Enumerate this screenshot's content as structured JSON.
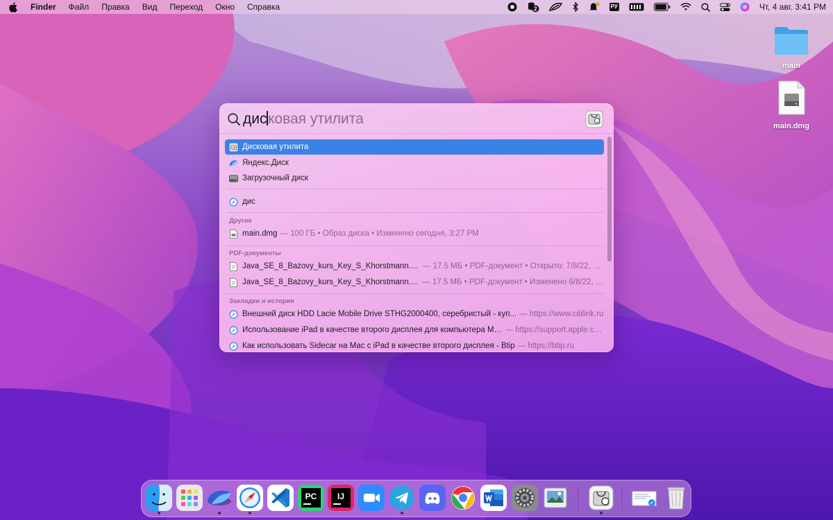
{
  "menubar": {
    "app_name": "Finder",
    "items": [
      "Файл",
      "Правка",
      "Вид",
      "Переход",
      "Окно",
      "Справка"
    ],
    "input_source": "РУ",
    "clock": "Чт, 4 авг.  3:41 PM",
    "status_icons": [
      "stop-icon",
      "notification-badge-icon",
      "racket-icon",
      "bluetooth-icon",
      "bell-icon",
      "keyboard-layout-icon",
      "battery-icon",
      "wifi-icon",
      "search-icon",
      "control-center-icon",
      "siri-icon"
    ],
    "badge_count": "2"
  },
  "desktop": {
    "icons": [
      {
        "label": "main",
        "icon": "folder-icon"
      },
      {
        "label": "main.dmg",
        "icon": "disk-image-icon"
      }
    ]
  },
  "spotlight": {
    "typed": "дис",
    "completion": "ковая утилита",
    "results": [
      {
        "title": "Дисковая утилита",
        "meta": "",
        "icon": "disk-utility-icon",
        "selected": true
      },
      {
        "title": "Яндекс.Диск",
        "meta": "",
        "icon": "yandex-disk-icon",
        "selected": false
      },
      {
        "title": "Загрузочный диск",
        "meta": "",
        "icon": "startup-disk-icon",
        "selected": false
      }
    ],
    "web_suggestion": {
      "title": "дис",
      "icon": "safari-icon"
    },
    "sections": {
      "other": {
        "label": "Другие",
        "items": [
          {
            "title": "main.dmg",
            "meta": "— 100 ГБ • Образ диска • Изменено сегодня, 3:27 PM",
            "icon": "document-icon"
          }
        ]
      },
      "pdf": {
        "label": "PDF-документы",
        "items": [
          {
            "title": "Java_SE_8_Bazovy_kurs_Key_S_Khorstmann.pdf",
            "meta": "— 17.5 МБ • PDF-документ • Открыто: 7/8/22, 4:...",
            "icon": "pdf-icon"
          },
          {
            "title": "Java_SE_8_Bazovy_kurs_Key_S_Khorstmann.pdf",
            "meta": "— 17.5 МБ • PDF-документ • Изменено 6/8/22, 2...",
            "icon": "pdf-icon"
          }
        ]
      },
      "bookmarks": {
        "label": "Закладки и история",
        "items": [
          {
            "title": "Внешний диск HDD Lacie Mobile Drive STHG2000400, серебристый - куп...",
            "meta": "— https://www.citilink.ru",
            "icon": "safari-icon"
          },
          {
            "title": "Использование iPad в качестве второго дисплея для компьютера Ma...",
            "meta": "— https://support.apple.com",
            "icon": "safari-icon"
          },
          {
            "title": "Как использовать Sidecar на Mac с iPad в качестве второго дисплея - Btip",
            "meta": "— https://btip.ru",
            "icon": "safari-icon"
          }
        ]
      }
    }
  },
  "dock": {
    "apps": [
      {
        "name": "finder-icon",
        "running": true
      },
      {
        "name": "launchpad-icon",
        "running": false
      },
      {
        "name": "yandex-disk-icon",
        "running": true
      },
      {
        "name": "safari-icon",
        "running": true
      },
      {
        "name": "vscode-icon",
        "running": false
      },
      {
        "name": "pycharm-icon",
        "running": false,
        "text": "PC"
      },
      {
        "name": "intellij-icon",
        "running": false,
        "text": "IJ"
      },
      {
        "name": "zoom-icon",
        "running": false
      },
      {
        "name": "telegram-icon",
        "running": true
      },
      {
        "name": "discord-icon",
        "running": false
      },
      {
        "name": "chrome-icon",
        "running": false
      },
      {
        "name": "word-icon",
        "running": false
      },
      {
        "name": "system-preferences-icon",
        "running": false
      },
      {
        "name": "preview-icon",
        "running": false
      },
      {
        "name": "disk-utility-icon",
        "running": true
      },
      {
        "name": "downloads-stack-icon",
        "running": false
      },
      {
        "name": "trash-icon",
        "running": false
      }
    ]
  },
  "colors": {
    "selection": "#3b82e6",
    "accent": "#3b82e6"
  }
}
